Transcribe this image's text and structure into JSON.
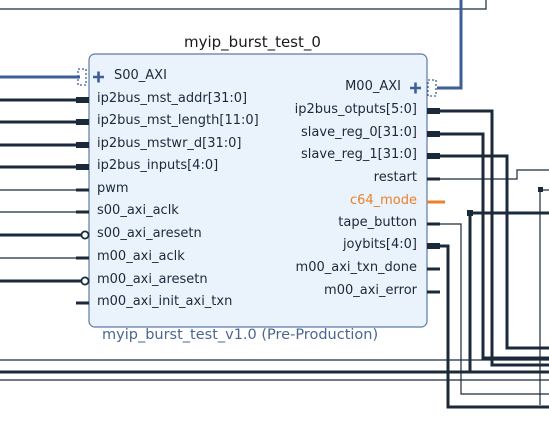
{
  "block": {
    "title": "myip_burst_test_0",
    "subtitle": "myip_burst_test_v1.0 (Pre-Production)"
  },
  "left_ports": [
    {
      "label": "S00_AXI",
      "kind": "bus"
    },
    {
      "label": "ip2bus_mst_addr[31:0]",
      "kind": "vector"
    },
    {
      "label": "ip2bus_mst_length[11:0]",
      "kind": "vector"
    },
    {
      "label": "ip2bus_mstwr_d[31:0]",
      "kind": "vector"
    },
    {
      "label": "ip2bus_inputs[4:0]",
      "kind": "vector"
    },
    {
      "label": "pwm",
      "kind": "wire"
    },
    {
      "label": "s00_axi_aclk",
      "kind": "wire"
    },
    {
      "label": "s00_axi_aresetn",
      "kind": "inverted"
    },
    {
      "label": "m00_axi_aclk",
      "kind": "wire"
    },
    {
      "label": "m00_axi_aresetn",
      "kind": "inverted"
    },
    {
      "label": "m00_axi_init_axi_txn",
      "kind": "wire"
    }
  ],
  "right_ports": [
    {
      "label": "M00_AXI",
      "kind": "bus"
    },
    {
      "label": "ip2bus_otputs[5:0]",
      "kind": "vector"
    },
    {
      "label": "slave_reg_0[31:0]",
      "kind": "vector"
    },
    {
      "label": "slave_reg_1[31:0]",
      "kind": "vector"
    },
    {
      "label": "restart",
      "kind": "wire"
    },
    {
      "label": "c64_mode",
      "kind": "highlight"
    },
    {
      "label": "tape_button",
      "kind": "wire"
    },
    {
      "label": "joybits[4:0]",
      "kind": "vector"
    },
    {
      "label": "m00_axi_txn_done",
      "kind": "wire"
    },
    {
      "label": "m00_axi_error",
      "kind": "wire"
    }
  ],
  "colors": {
    "block_fill": "#eaf2fb",
    "block_border": "#5d7aa8",
    "bus": "#3d5f98",
    "wire": "#1b2a3a",
    "highlight": "#e8822a"
  }
}
